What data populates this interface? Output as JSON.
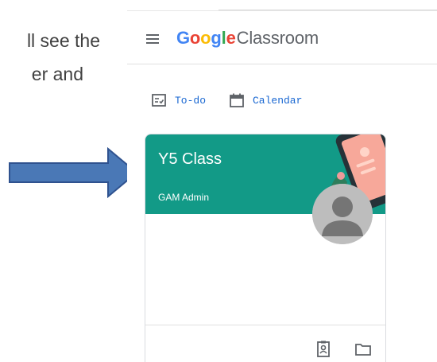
{
  "document": {
    "line1": "ll see the",
    "line2": "er and"
  },
  "app": {
    "brand_google": [
      "G",
      "o",
      "o",
      "g",
      "l",
      "e"
    ],
    "brand_app": "Classroom"
  },
  "nav": {
    "todo_label": "To-do",
    "calendar_label": "Calendar"
  },
  "class_card": {
    "title": "Y5 Class",
    "owner": "GAM Admin",
    "header_color": "#129a87"
  },
  "icons": {
    "menu": "hamburger-menu-icon",
    "todo": "todo-checklist-icon",
    "calendar": "calendar-icon",
    "avatar": "default-person-avatar",
    "portfolio": "portfolio-icon",
    "folder": "folder-icon",
    "arrow": "right-arrow-pointer"
  },
  "colors": {
    "arrow_fill": "#4a78b6",
    "arrow_stroke": "#2f528f",
    "link_blue": "#1967d2"
  }
}
